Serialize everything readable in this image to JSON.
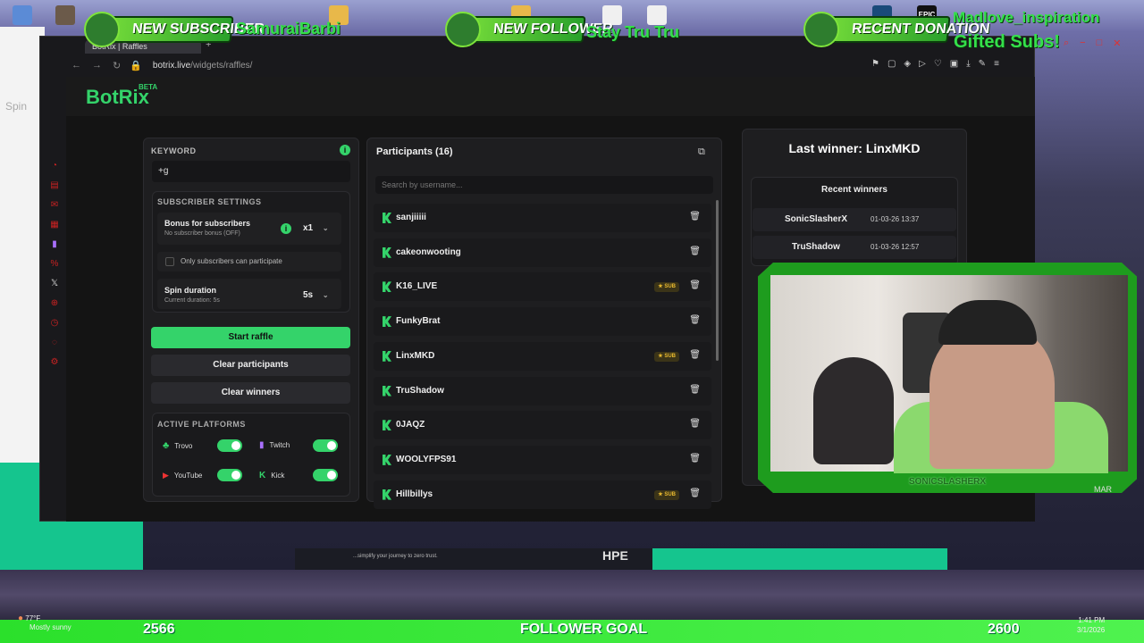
{
  "overlay": {
    "alert1": {
      "label": "NEW SUBSCRIBER",
      "name": "SamuraiBarbi"
    },
    "alert2": {
      "label": "NEW FOLLOWER",
      "name": "Stay Tru Tru"
    },
    "alert3": {
      "label": "RECENT DONATION",
      "name": "Madlove_inspiration"
    },
    "gifted": "Gifted Subs!",
    "goal_start": "2566",
    "goal_label": "FOLLOWER GOAL",
    "goal_end": "2600",
    "cam_label": "SONICSLASHERX",
    "desktop_text": "Spin",
    "mar": "MAR"
  },
  "browser": {
    "tab_title": "BotRix | Raffles",
    "url_domain": "botrix.live",
    "url_path": "/widgets/raffles/"
  },
  "app": {
    "logo": "BotRix",
    "beta": "BETA"
  },
  "settings": {
    "keyword_label": "KEYWORD",
    "keyword_value": "+g",
    "subscriber_section": "SUBSCRIBER SETTINGS",
    "bonus_title": "Bonus for subscribers",
    "bonus_sub": "No subscriber bonus (OFF)",
    "bonus_value": "x1",
    "only_subs": "Only subscribers can participate",
    "spin_title": "Spin duration",
    "spin_sub": "Current duration: 5s",
    "spin_value": "5s",
    "start_button": "Start raffle",
    "clear_participants": "Clear participants",
    "clear_winners": "Clear winners",
    "platforms_label": "ACTIVE PLATFORMS",
    "platforms": [
      {
        "name": "Trovo",
        "on": true
      },
      {
        "name": "Twitch",
        "on": true
      },
      {
        "name": "YouTube",
        "on": true
      },
      {
        "name": "Kick",
        "on": true
      }
    ]
  },
  "participants": {
    "title": "Participants (16)",
    "search_placeholder": "Search by username...",
    "sub_badge": "SUB",
    "list": [
      {
        "name": "sanjiiiii",
        "sub": false
      },
      {
        "name": "cakeonwooting",
        "sub": false
      },
      {
        "name": "K16_LIVE",
        "sub": true
      },
      {
        "name": "FunkyBrat",
        "sub": false
      },
      {
        "name": "LinxMKD",
        "sub": true
      },
      {
        "name": "TruShadow",
        "sub": false
      },
      {
        "name": "0JAQZ",
        "sub": false
      },
      {
        "name": "WOOLYFPS91",
        "sub": false
      },
      {
        "name": "Hillbillys",
        "sub": true
      }
    ]
  },
  "winners": {
    "last_winner": "Last winner: LinxMKD",
    "recent_title": "Recent winners",
    "list": [
      {
        "name": "SonicSlasherX",
        "time": "01-03-26 13:37"
      },
      {
        "name": "TruShadow",
        "time": "01-03-26 12:57"
      }
    ]
  },
  "taskbar": {
    "temp": "77°F",
    "weather": "Mostly sunny",
    "time": "1:41 PM",
    "date": "3/1/2026"
  },
  "promo": {
    "brand": "HPE",
    "text": "...simplify your journey to zero trust."
  },
  "colors": {
    "accent": "#34d36a",
    "sub_badge": "#e8b92f",
    "overlay_green": "#34e04a"
  }
}
